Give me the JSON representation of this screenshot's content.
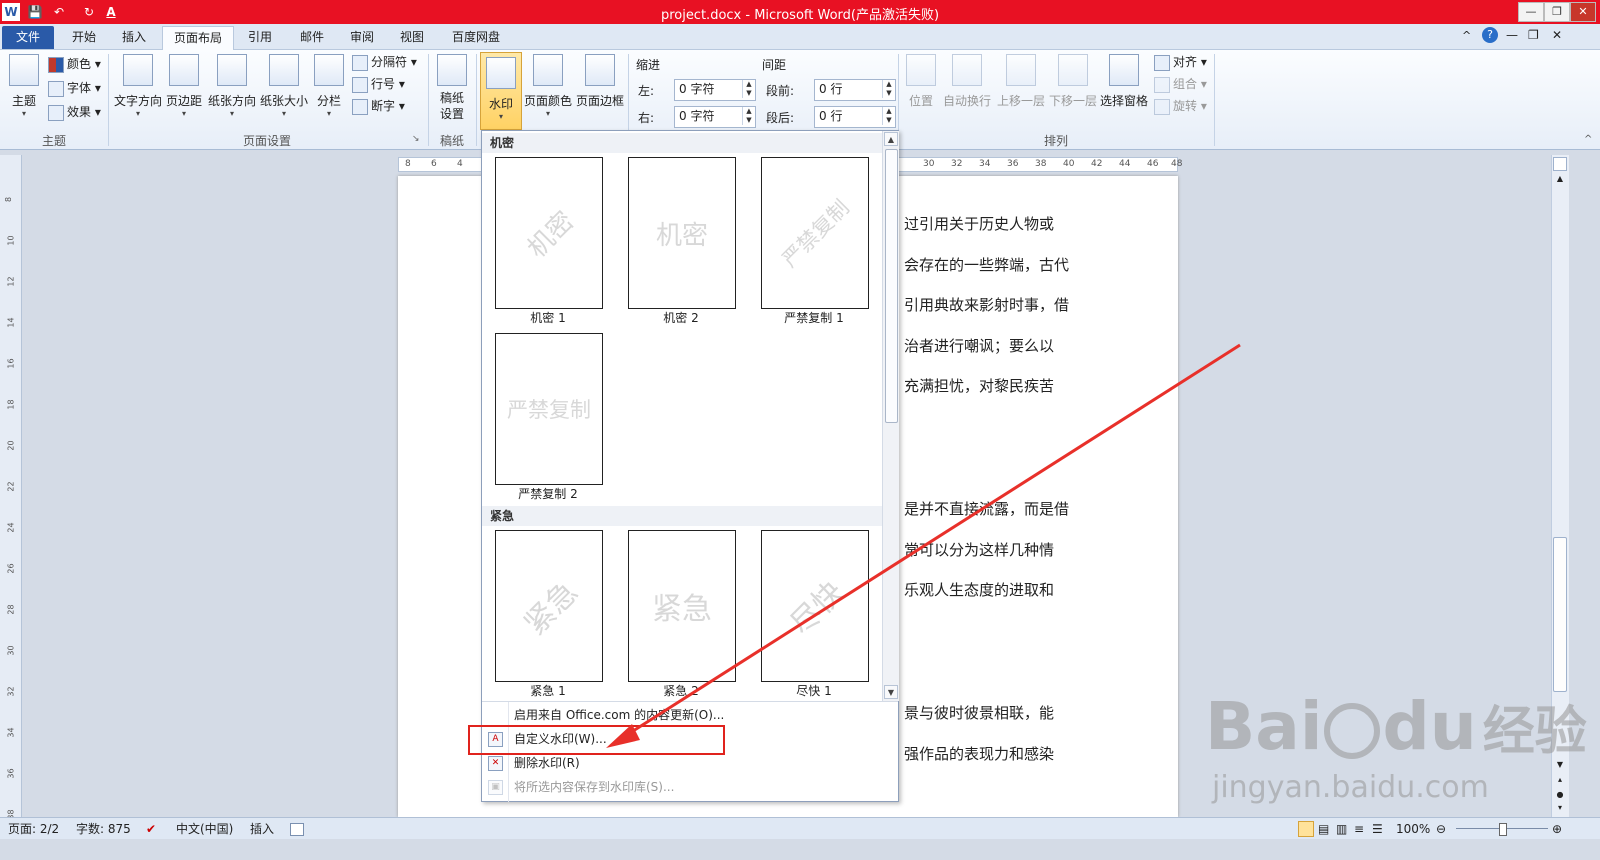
{
  "window": {
    "title": "project.docx  -  Microsoft Word(产品激活失败)",
    "quick_access": [
      "W",
      "💾",
      "↶",
      "↻",
      "A"
    ],
    "controls": [
      "—",
      "❐",
      "✕"
    ],
    "right_icons": [
      "^",
      "?",
      "—",
      "❐",
      "✕"
    ]
  },
  "tabs": [
    "文件",
    "开始",
    "插入",
    "页面布局",
    "引用",
    "邮件",
    "审阅",
    "视图",
    "百度网盘"
  ],
  "ribbon": {
    "theme_group": {
      "label": "主题",
      "big_button": "主题",
      "items": [
        "颜色",
        "字体",
        "效果"
      ]
    },
    "page_setup_group": {
      "label": "页面设置",
      "buttons": [
        "文字方向",
        "页边距",
        "纸张方向",
        "纸张大小",
        "分栏"
      ],
      "small_buttons": [
        "分隔符",
        "行号",
        "断字"
      ]
    },
    "manuscript_group": {
      "label": "稿纸",
      "button_line1": "稿纸",
      "button_line2": "设置"
    },
    "background_group": {
      "buttons": [
        "水印",
        "页面颜色",
        "页面边框"
      ]
    },
    "indent": {
      "label": "缩进",
      "left_label": "左:",
      "left_value": "0 字符",
      "right_label": "右:",
      "right_value": "0 字符"
    },
    "spacing": {
      "label": "间距",
      "before_label": "段前:",
      "before_value": "0 行",
      "after_label": "段后:",
      "after_value": "0 行"
    },
    "arrange_group": {
      "label": "排列",
      "buttons": [
        "位置",
        "自动换行",
        "上移一层",
        "下移一层",
        "选择窗格"
      ],
      "small_buttons": [
        "对齐",
        "组合",
        "旋转"
      ]
    }
  },
  "ruler": {
    "top_ticks": [
      "8",
      "6",
      "4",
      "30",
      "32",
      "34",
      "36",
      "38",
      "40",
      "42",
      "44",
      "46",
      "48"
    ],
    "left_ticks": [
      "8",
      "10",
      "12",
      "14",
      "16",
      "18",
      "20",
      "22",
      "24",
      "26",
      "28",
      "30",
      "32",
      "34",
      "36",
      "38"
    ]
  },
  "document": {
    "lines": [
      "过引用关于历史人物或",
      "会存在的一些弊端，古代",
      "引用典故来影射时事，借",
      "治者进行嘲讽；要么以",
      "充满担忧，对黎民疾苦",
      "是并不直接流露，而是借",
      "常可以分为这样几种情",
      "乐观人生态度的进取和",
      "景与彼时彼景相联，能",
      "强作品的表现力和感染"
    ]
  },
  "watermark_menu": {
    "section1_title": "机密",
    "section1_items": [
      {
        "text": "机密",
        "caption": "机密 1",
        "style": "diagonal"
      },
      {
        "text": "机密",
        "caption": "机密 2",
        "style": "horizontal"
      },
      {
        "text": "严禁复制",
        "caption": "严禁复制 1",
        "style": "diagonal"
      },
      {
        "text": "严禁复制",
        "caption": "严禁复制 2",
        "style": "horizontal"
      }
    ],
    "section2_title": "紧急",
    "section2_items": [
      {
        "text": "紧急",
        "caption": "紧急 1",
        "style": "diagonal"
      },
      {
        "text": "紧急",
        "caption": "紧急 2",
        "style": "horizontal"
      },
      {
        "text": "尽快",
        "caption": "尽快 1",
        "style": "diagonal"
      }
    ],
    "menu_items": [
      {
        "label": "启用来自 Office.com 的内容更新(O)...",
        "enabled": true
      },
      {
        "label": "自定义水印(W)...",
        "enabled": true
      },
      {
        "label": "删除水印(R)",
        "enabled": true
      },
      {
        "label": "将所选内容保存到水印库(S)...",
        "enabled": false
      }
    ]
  },
  "statusbar": {
    "page": "页面: 2/2",
    "words": "字数: 875",
    "language": "中文(中国)",
    "mode": "插入",
    "zoom": "100%",
    "zoom_level": 1.0
  },
  "baidu_watermark": {
    "brand": "Bai",
    "brand2": "du",
    "cn": "经验",
    "url": "jingyan.baidu.com"
  },
  "colors": {
    "title_bar": "#e81123",
    "file_tab": "#2a5aa8",
    "highlight": "#e0231d",
    "arrow": "#e8302a"
  }
}
